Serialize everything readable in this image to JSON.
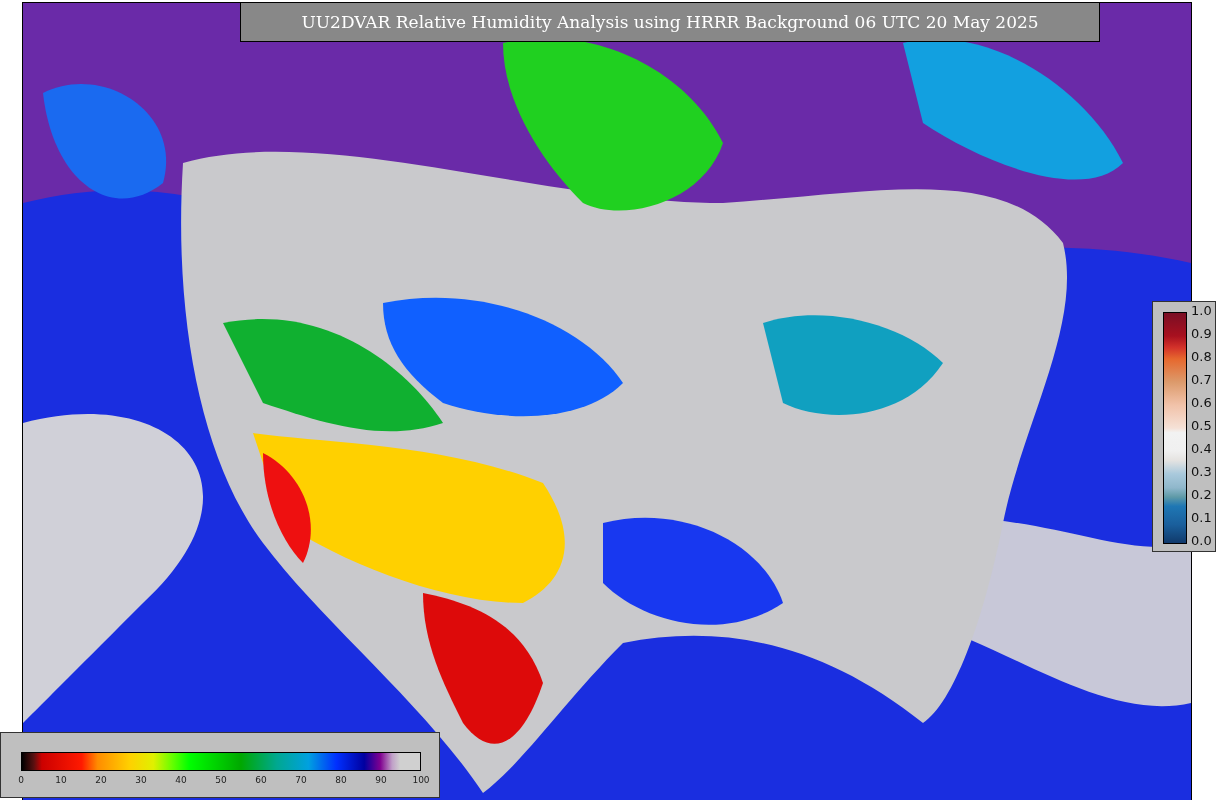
{
  "title": "UU2DVAR Relative Humidity Analysis using HRRR Background 06 UTC 20 May 2025",
  "ratio_colorbar": {
    "ticks": [
      "1.0",
      "0.9",
      "0.8",
      "0.7",
      "0.6",
      "0.5",
      "0.4",
      "0.3",
      "0.2",
      "0.1",
      "0.0"
    ]
  },
  "humidity_colorbar": {
    "ticks": [
      "0",
      "10",
      "20",
      "30",
      "40",
      "50",
      "60",
      "70",
      "80",
      "90",
      "100"
    ]
  }
}
